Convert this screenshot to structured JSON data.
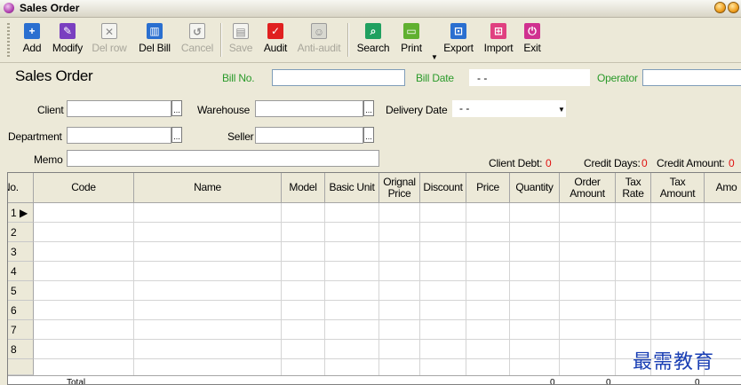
{
  "window": {
    "title": "Sales Order"
  },
  "toolbar": {
    "buttons": [
      {
        "id": "add",
        "label": "Add",
        "icon": "plus-icon",
        "color": "#2a6fd0",
        "disabled": false
      },
      {
        "id": "modify",
        "label": "Modify",
        "icon": "edit-icon",
        "color": "#7a3fc0",
        "disabled": false
      },
      {
        "id": "delrow",
        "label": "Del row",
        "icon": "close-box-icon",
        "color": "#9a9a9a",
        "disabled": true
      },
      {
        "id": "delbill",
        "label": "Del Bill",
        "icon": "trash-icon",
        "color": "#2a6fd0",
        "disabled": false
      },
      {
        "id": "cancel",
        "label": "Cancel",
        "icon": "undo-icon",
        "color": "#9a9a9a",
        "disabled": true
      },
      {
        "id": "save",
        "label": "Save",
        "icon": "floppy-icon",
        "color": "#9a9a9a",
        "disabled": true
      },
      {
        "id": "audit",
        "label": "Audit",
        "icon": "checkmark-icon",
        "color": "#e02020",
        "disabled": false
      },
      {
        "id": "antiaudit",
        "label": "Anti-audit",
        "icon": "people-icon",
        "color": "#9a9a9a",
        "disabled": true
      },
      {
        "id": "search",
        "label": "Search",
        "icon": "magnifier-icon",
        "color": "#20a060",
        "disabled": false
      },
      {
        "id": "print",
        "label": "Print",
        "icon": "printer-icon",
        "color": "#60b030",
        "disabled": false
      },
      {
        "id": "export",
        "label": "Export",
        "icon": "export-icon",
        "color": "#2a6fd0",
        "disabled": false
      },
      {
        "id": "import",
        "label": "Import",
        "icon": "import-icon",
        "color": "#e04080",
        "disabled": false
      },
      {
        "id": "exit",
        "label": "Exit",
        "icon": "power-icon",
        "color": "#d03090",
        "disabled": false
      }
    ]
  },
  "form": {
    "title": "Sales Order",
    "bill_no_label": "Bill No.",
    "bill_no_value": "",
    "bill_date_label": "Bill Date",
    "bill_date_value": "- -",
    "operator_label": "Operator",
    "operator_value": "",
    "client_label": "Client",
    "client_value": "",
    "warehouse_label": "Warehouse",
    "warehouse_value": "",
    "delivery_date_label": "Delivery Date",
    "delivery_date_value": "- -",
    "department_label": "Department",
    "department_value": "",
    "seller_label": "Seller",
    "seller_value": "",
    "memo_label": "Memo",
    "memo_value": "",
    "client_debt_label": "Client Debt:",
    "client_debt_value": "0",
    "credit_days_label": "Credit Days:",
    "credit_days_value": "0",
    "credit_amount_label": "Credit Amount:",
    "credit_amount_value": "0"
  },
  "grid": {
    "columns": [
      "No.",
      "Code",
      "Name",
      "Model",
      "Basic Unit",
      "Orignal Price",
      "Discount",
      "Price",
      "Quantity",
      "Order Amount",
      "Tax Rate",
      "Tax Amount",
      "Amo"
    ],
    "rows": [
      "1",
      "2",
      "3",
      "4",
      "5",
      "6",
      "7",
      "8"
    ],
    "current_row_marker": "▶",
    "total_label": "Total",
    "totals": [
      "0",
      "0",
      "0"
    ]
  },
  "watermark": "最需教育"
}
